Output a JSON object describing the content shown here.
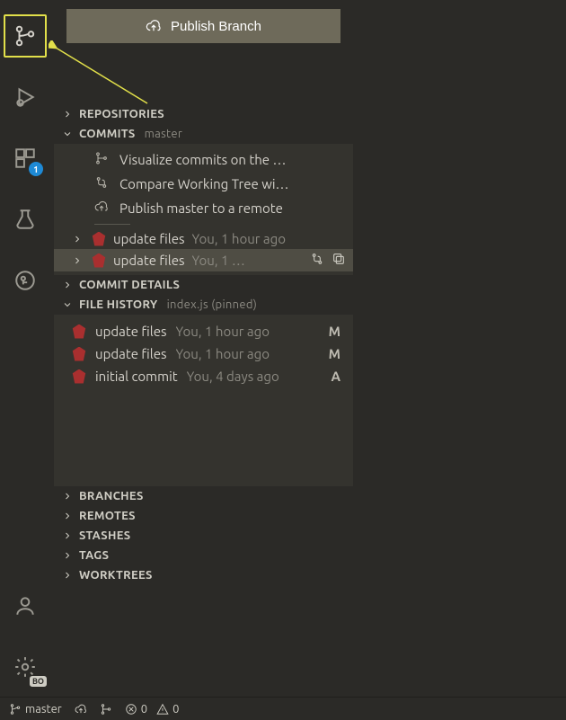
{
  "publish": {
    "label": "Publish Branch"
  },
  "activity": {
    "extensions_badge": "1",
    "settings_badge": "BO"
  },
  "sections": {
    "repositories": "REPOSITORIES",
    "commits": {
      "label": "COMMITS",
      "hint": "master"
    },
    "commit_details": "COMMIT DETAILS",
    "file_history": {
      "label": "FILE HISTORY",
      "hint": "index.js (pinned)"
    },
    "branches": "BRANCHES",
    "remotes": "REMOTES",
    "stashes": "STASHES",
    "tags": "TAGS",
    "worktrees": "WORKTREES"
  },
  "commit_actions": {
    "visualize": "Visualize commits on the …",
    "compare": "Compare Working Tree wi…",
    "publish": "Publish master to a remote"
  },
  "commits": [
    {
      "msg": "update files",
      "meta": "You, 1 hour ago"
    },
    {
      "msg": "update files",
      "meta": "You, 1 …"
    }
  ],
  "file_history": [
    {
      "msg": "update files",
      "meta": "You, 1 hour ago",
      "status": "M"
    },
    {
      "msg": "update files",
      "meta": "You, 1 hour ago",
      "status": "M"
    },
    {
      "msg": "initial commit",
      "meta": "You, 4 days ago",
      "status": "A"
    }
  ],
  "statusbar": {
    "branch": "master",
    "errors": "0",
    "warnings": "0"
  }
}
